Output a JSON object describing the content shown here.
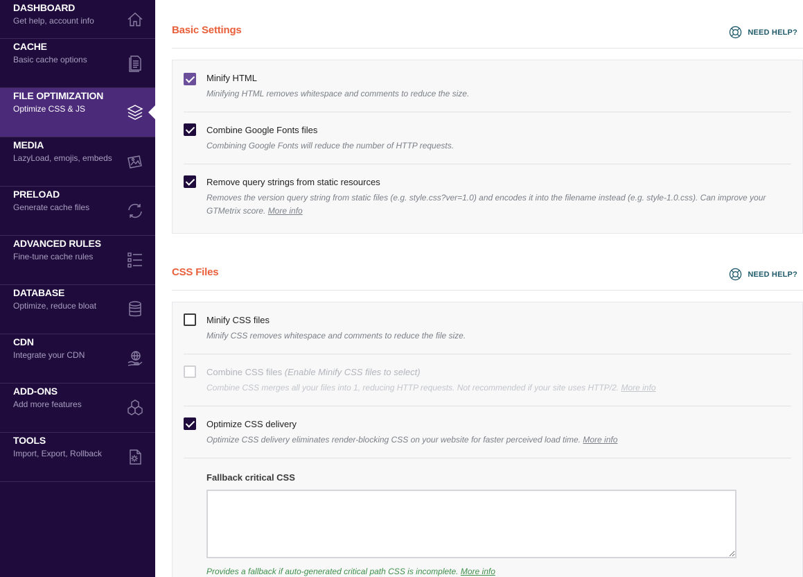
{
  "sidebar": {
    "items": [
      {
        "title": "DASHBOARD",
        "subtitle": "Get help, account info",
        "icon": "home-icon"
      },
      {
        "title": "CACHE",
        "subtitle": "Basic cache options",
        "icon": "document-icon"
      },
      {
        "title": "FILE OPTIMIZATION",
        "subtitle": "Optimize CSS & JS",
        "icon": "layers-icon",
        "active": true
      },
      {
        "title": "MEDIA",
        "subtitle": "LazyLoad, emojis, embeds",
        "icon": "images-icon"
      },
      {
        "title": "PRELOAD",
        "subtitle": "Generate cache files",
        "icon": "refresh-icon"
      },
      {
        "title": "ADVANCED RULES",
        "subtitle": "Fine-tune cache rules",
        "icon": "list-icon"
      },
      {
        "title": "DATABASE",
        "subtitle": "Optimize, reduce bloat",
        "icon": "database-icon"
      },
      {
        "title": "CDN",
        "subtitle": "Integrate your CDN",
        "icon": "globe-hand-icon"
      },
      {
        "title": "ADD-ONS",
        "subtitle": "Add more features",
        "icon": "cubes-icon"
      },
      {
        "title": "TOOLS",
        "subtitle": "Import, Export, Rollback",
        "icon": "file-gear-icon"
      }
    ]
  },
  "basic": {
    "title": "Basic Settings",
    "help": "NEED HELP?",
    "fields": [
      {
        "label": "Minify HTML",
        "desc": "Minifying HTML removes whitespace and comments to reduce the size.",
        "checked": true
      },
      {
        "label": "Combine Google Fonts files",
        "desc": "Combining Google Fonts will reduce the number of HTTP requests.",
        "checked": true
      },
      {
        "label": "Remove query strings from static resources",
        "desc": "Removes the version query string from static files (e.g. style.css?ver=1.0) and encodes it into the filename instead (e.g. style-1.0.css). Can improve your GTMetrix score.",
        "more": "More info",
        "checked": true
      }
    ]
  },
  "css": {
    "title": "CSS Files",
    "help": "NEED HELP?",
    "fields": [
      {
        "label": "Minify CSS files",
        "desc": "Minify CSS removes whitespace and comments to reduce the file size.",
        "checked": false
      },
      {
        "label": "Combine CSS files",
        "hint": "(Enable Minify CSS files to select)",
        "desc": "Combine CSS merges all your files into 1, reducing HTTP requests. Not recommended if your site uses HTTP/2.",
        "more": "More info",
        "checked": false,
        "disabled": true
      },
      {
        "label": "Optimize CSS delivery",
        "desc": "Optimize CSS delivery eliminates render-blocking CSS on your website for faster perceived load time.",
        "more": "More info",
        "checked": true
      }
    ],
    "fallback": {
      "label": "Fallback critical CSS",
      "value": "",
      "hint": "Provides a fallback if auto-generated critical path CSS is incomplete.",
      "more": "More info"
    }
  },
  "colors": {
    "sidebar_bg": "#1f0c3c",
    "sidebar_active": "#4b2a7a",
    "section_title": "#e9603c",
    "help_link": "#1f5a6a"
  }
}
